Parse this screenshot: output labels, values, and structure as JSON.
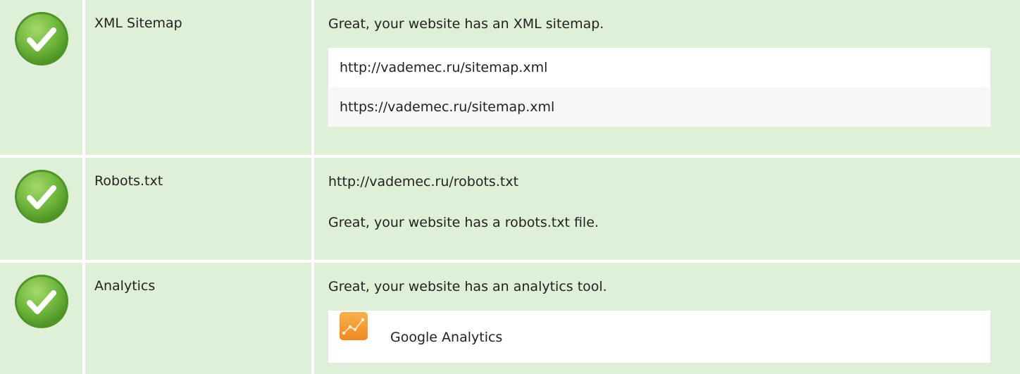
{
  "rows": [
    {
      "status": "check-icon",
      "name": "XML Sitemap",
      "message": "Great, your website has an XML sitemap.",
      "urls": [
        "http://vademec.ru/sitemap.xml",
        "https://vademec.ru/sitemap.xml"
      ]
    },
    {
      "status": "check-icon",
      "name": "Robots.txt",
      "line1": "http://vademec.ru/robots.txt",
      "line2": "Great, your website has a robots.txt file."
    },
    {
      "status": "check-icon",
      "name": "Analytics",
      "message": "Great, your website has an analytics tool.",
      "tools": [
        {
          "name": "Google Analytics",
          "icon": "google-analytics-icon"
        }
      ]
    }
  ],
  "colors": {
    "row_background": "#dff0d8",
    "check_green": "#6cb43a",
    "analytics_orange": "#f5a038"
  }
}
